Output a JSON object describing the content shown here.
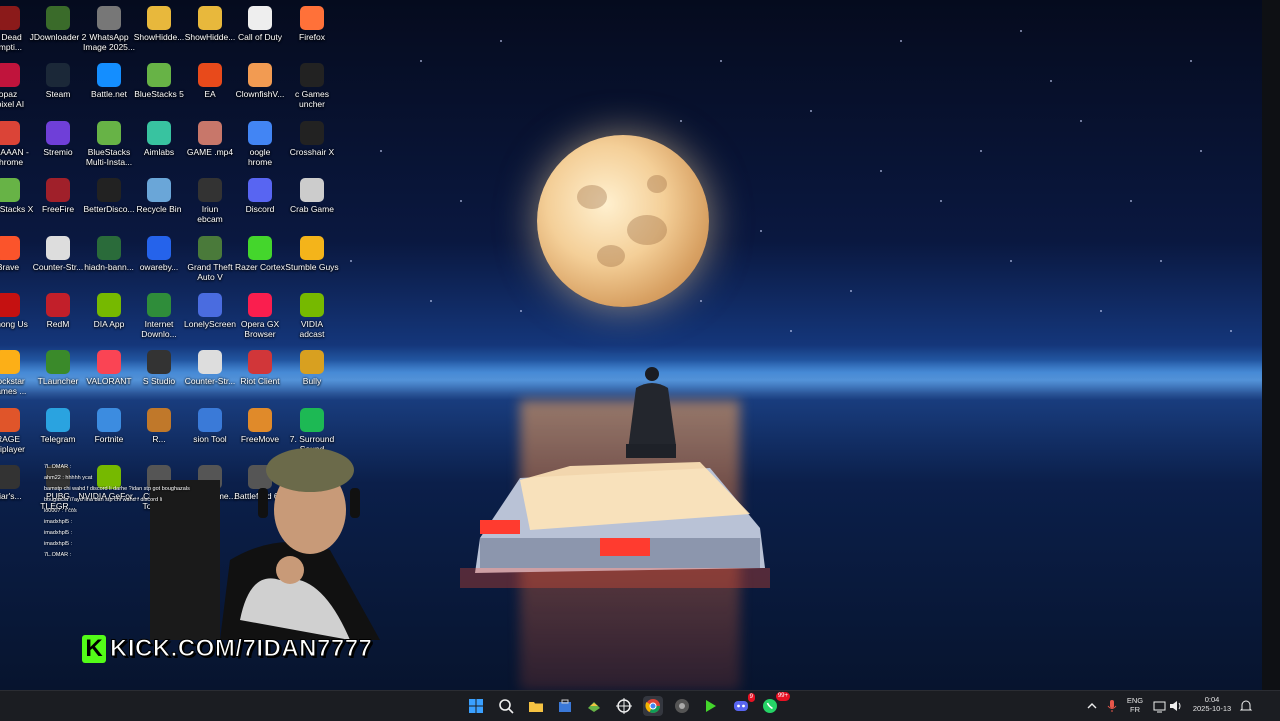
{
  "desktop": {
    "icons": [
      {
        "label": "d Dead\nempti...",
        "color": "#8b1a1a"
      },
      {
        "label": "JDownloader 2",
        "color": "#3a6b2a"
      },
      {
        "label": "WhatsApp Image 2025...",
        "color": "#777"
      },
      {
        "label": "ShowHidde...",
        "color": "#e8b83c"
      },
      {
        "label": "ShowHidde...",
        "color": "#e8b83c"
      },
      {
        "label": "Call of Duty",
        "color": "#eee"
      },
      {
        "label": "Firefox",
        "color": "#ff7139"
      },
      {
        "label": "opaz\napixel AI",
        "color": "#c0143c"
      },
      {
        "label": "Steam",
        "color": "#1b2838"
      },
      {
        "label": "Battle.net",
        "color": "#148eff"
      },
      {
        "label": "BlueStacks 5",
        "color": "#67b346"
      },
      {
        "label": "EA",
        "color": "#e84a1b"
      },
      {
        "label": "ClownfishV...",
        "color": "#f29b52"
      },
      {
        "label": "c Games\nuncher",
        "color": "#222"
      },
      {
        "label": "7IDAAAN - Chrome",
        "color": "#db4437"
      },
      {
        "label": "Stremio",
        "color": "#6f3fd8"
      },
      {
        "label": "BlueStacks Multi-Insta...",
        "color": "#67b346"
      },
      {
        "label": "Aimlabs",
        "color": "#38c3a0"
      },
      {
        "label": "GAME .mp4",
        "color": "#c8776a"
      },
      {
        "label": "oogle\nhrome",
        "color": "#4285f4"
      },
      {
        "label": "Crosshair X",
        "color": "#222"
      },
      {
        "label": "BlueStacks X",
        "color": "#67b346"
      },
      {
        "label": "FreeFire",
        "color": "#a0202a"
      },
      {
        "label": "BetterDisco...",
        "color": "#222"
      },
      {
        "label": "Recycle Bin",
        "color": "#6aa6d8"
      },
      {
        "label": "Iriun\nebcam",
        "color": "#333"
      },
      {
        "label": "Discord",
        "color": "#5865f2"
      },
      {
        "label": "Crab Game",
        "color": "#cccccc"
      },
      {
        "label": "Brave",
        "color": "#fb542b"
      },
      {
        "label": "Counter-Str...",
        "color": "#ddd"
      },
      {
        "label": "hiadn-bann...",
        "color": "#2a6b3a"
      },
      {
        "label": "owareby...",
        "color": "#2563eb"
      },
      {
        "label": "Grand Theft Auto V",
        "color": "#4a7a3a"
      },
      {
        "label": "Razer Cortex",
        "color": "#44d62c"
      },
      {
        "label": "Stumble Guys",
        "color": "#f4b41a"
      },
      {
        "label": "Among Us",
        "color": "#c51111"
      },
      {
        "label": "RedM",
        "color": "#c21f2a"
      },
      {
        "label": "DIA App",
        "color": "#76b900"
      },
      {
        "label": "Internet Downlo...",
        "color": "#2f8d3a"
      },
      {
        "label": "LonelyScreen",
        "color": "#4a6ce0"
      },
      {
        "label": "Opera GX Browser",
        "color": "#fa1e4e"
      },
      {
        "label": "VIDIA\nadcast",
        "color": "#76b900"
      },
      {
        "label": "Rockstar Games ...",
        "color": "#fcaf17"
      },
      {
        "label": "TLauncher",
        "color": "#3a8a2a"
      },
      {
        "label": "VALORANT",
        "color": "#fa4454"
      },
      {
        "label": "S Studio",
        "color": "#333"
      },
      {
        "label": "Counter-Str...",
        "color": "#ddd"
      },
      {
        "label": "Riot Client",
        "color": "#d13639"
      },
      {
        "label": "Bully",
        "color": "#d8a020"
      },
      {
        "label": "RAGE\nultiplayer",
        "color": "#e0552a"
      },
      {
        "label": "Telegram",
        "color": "#2aa3e0"
      },
      {
        "label": "Fortnite",
        "color": "#3c8ce0"
      },
      {
        "label": "R...",
        "color": "#c0782a"
      },
      {
        "label": "sion Tool",
        "color": "#3a7ad8"
      },
      {
        "label": "FreeMove",
        "color": "#e08a2a"
      },
      {
        "label": "7. Surround Sound",
        "color": "#1db954"
      },
      {
        "label": "Liar's...",
        "color": "#333"
      },
      {
        "label": "PUBG\nTLEGR...",
        "color": "#333"
      },
      {
        "label": "NVIDIA GeFor...",
        "color": "#76b900"
      },
      {
        "label": "Chained Together",
        "color": "#555"
      },
      {
        "label": "A Gentleme...",
        "color": "#555"
      },
      {
        "label": "Battlefield 6...",
        "color": "#555"
      }
    ]
  },
  "stream": {
    "kick_logo": "K",
    "kick_url": "KICK.COM/7IDAN7777",
    "chat": [
      "7L.OMAR :",
      "ahm22 : hhhhh ycat",
      "bamstp chi wahd f discord li darhe ?idan stp got boughazals",
      "bougas3a i7ayd lina ban stp chi wahd f discord li",
      "lo0007 : f cos",
      "imadxhpl5 :",
      "imadxhpl5 :",
      "imadxhpl5 :",
      "7L.OMAR :"
    ]
  },
  "taskbar": {
    "apps": [
      "Start",
      "Search",
      "File Explorer",
      "Microsoft Store",
      "BlueStacks",
      "Crosshair X",
      "Google Chrome",
      "Chrome Profile",
      "Razer Cortex",
      "Discord",
      "WhatsApp"
    ],
    "discord_badge": "9",
    "whatsapp_badge": "99+",
    "lang_top": "ENG",
    "lang_bottom": "FR",
    "time": "0:04",
    "date": "2025-10-13"
  }
}
